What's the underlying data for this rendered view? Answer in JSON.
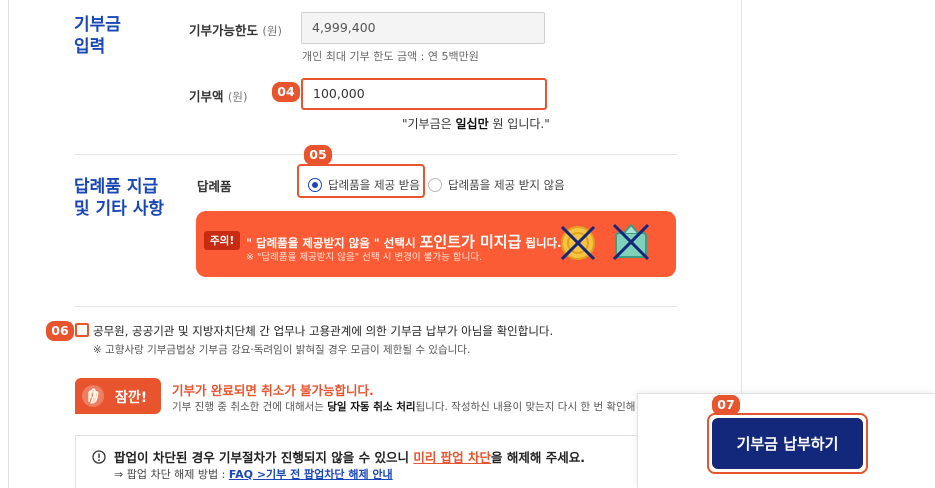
{
  "donation_input": {
    "section_title_line1": "기부금",
    "section_title_line2": "입력",
    "limit_label": "기부가능한도",
    "limit_unit": "(원)",
    "limit_value": "4,999,400",
    "limit_hint": "개인 최대 기부 한도 금액 : 연 5백만원",
    "amount_label": "기부액",
    "amount_unit": "(원)",
    "amount_step": "04",
    "amount_value": "100,000",
    "amount_note_prefix": "\"기부금은 ",
    "amount_note_bold": "일십만",
    "amount_note_suffix": " 원 입니다.\""
  },
  "gift": {
    "step": "05",
    "section_title_line1": "답례품 지급",
    "section_title_line2": "및 기타 사항",
    "label": "답례품",
    "option_receive": "답례품을 제공 받음",
    "option_decline": "답례품을 제공 받지 않음",
    "selected": "답례품을 제공 받음",
    "warning": {
      "tag": "주의!",
      "main_prefix": "\" 답례품을 제공받지 않음 \" 선택시 ",
      "main_big": "포인트가 미지급",
      "main_suffix": " 됩니다.",
      "sub": "※ \"답례품을 제공받지 않음\" 선택 시 변경이 불가능 합니다."
    }
  },
  "confirm": {
    "step": "06",
    "text": "공무원, 공공기관 및 지방자치단체 간 업무나 고용관계에 의한 기부금 납부가 아님을 확인합니다.",
    "sub": "※ 고향사랑 기부금법상 기부금 강요·독려임이 밝혀질 경우 모금이 제한될 수 있습니다."
  },
  "caution": {
    "tag": "잠깐!",
    "headline": "기부가 완료되면 취소가 불가능합니다.",
    "detail_prefix": "기부 진행 중 취소한 건에 대해서는 ",
    "detail_bold": "당일 자동 취소 처리",
    "detail_suffix": "됩니다. 작성하신 내용이 맞는지 다시 한 번 확인해 주세"
  },
  "popup_notice": {
    "main_prefix": "팝업이 차단된 경우 기부절차가 진행되지 않을 수 있으니 ",
    "main_highlight": "미리 팝업 차단",
    "main_suffix": "을 해제해 주세요.",
    "method_prefix": "⇒ 팝업 차단 해제 방법 : ",
    "method_link": "FAQ >기부 전 팝업차단 해제 안내"
  },
  "submit": {
    "step": "07",
    "label": "기부금 납부하기"
  },
  "colors": {
    "accent": "#e8542e",
    "brand_blue": "#1a47b8",
    "navy": "#13287a",
    "warning_bg": "#fb5c35"
  }
}
